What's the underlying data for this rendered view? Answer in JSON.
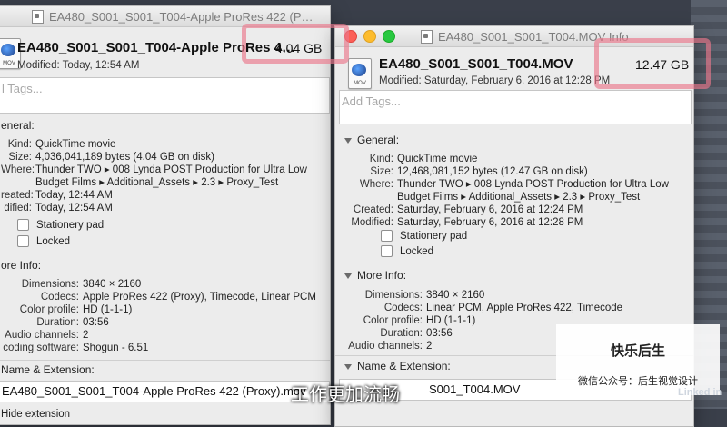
{
  "left_window": {
    "title": "EA480_S001_S001_T004-Apple ProRes 422 (P…",
    "filename": "EA480_S001_S001_T004-Apple ProRes 4…",
    "size": "4.04 GB",
    "modified": "Modified: Today, 12:54 AM",
    "tags_placeholder": "l Tags...",
    "general_label": "eneral:",
    "kind_k": "Kind:",
    "kind_v": "QuickTime movie",
    "size_k": "Size:",
    "size_v": "4,036,041,189 bytes (4.04 GB on disk)",
    "where_k": "Where:",
    "where_v1": "Thunder TWO ▸ 008 Lynda POST Production for Ultra Low",
    "where_v2": "Budget Films ▸ Additional_Assets ▸ 2.3 ▸ Proxy_Test",
    "created_k": "reated:",
    "created_v": "Today, 12:44 AM",
    "modified_k": "dified:",
    "modified_v": "Today, 12:54 AM",
    "stationery": "Stationery pad",
    "locked": "Locked",
    "more_info_label": "ore Info:",
    "dimensions_k": "Dimensions:",
    "dimensions_v": "3840 × 2160",
    "codecs_k": "Codecs:",
    "codecs_v": "Apple ProRes 422 (Proxy), Timecode, Linear PCM",
    "color_k": "Color profile:",
    "color_v": "HD (1-1-1)",
    "duration_k": "Duration:",
    "duration_v": "03:56",
    "audio_k": "Audio channels:",
    "audio_v": "2",
    "enc_k": "coding software:",
    "enc_v": "Shogun - 6.51",
    "name_ext_label": "Name & Extension:",
    "name_value": "EA480_S001_S001_T004-Apple ProRes 422 (Proxy).mov",
    "hide_ext": "Hide extension"
  },
  "right_window": {
    "title": "EA480_S001_S001_T004.MOV Info",
    "filename": "EA480_S001_S001_T004.MOV",
    "size": "12.47 GB",
    "modified": "Modified: Saturday, February 6, 2016 at 12:28 PM",
    "tags_placeholder": "Add Tags...",
    "general_label": "General:",
    "kind_k": "Kind:",
    "kind_v": "QuickTime movie",
    "size_k": "Size:",
    "size_v": "12,468,081,152 bytes (12.47 GB on disk)",
    "where_k": "Where:",
    "where_v1": "Thunder TWO ▸ 008 Lynda POST Production for Ultra Low",
    "where_v2": "Budget Films ▸ Additional_Assets ▸ 2.3 ▸ Proxy_Test",
    "created_k": "Created:",
    "created_v": "Saturday, February 6, 2016 at 12:24 PM",
    "modified_k": "Modified:",
    "modified_v": "Saturday, February 6, 2016 at 12:28 PM",
    "stationery": "Stationery pad",
    "locked": "Locked",
    "more_info_label": "More Info:",
    "dimensions_k": "Dimensions:",
    "dimensions_v": "3840 × 2160",
    "codecs_k": "Codecs:",
    "codecs_v": "Linear PCM, Apple ProRes 422, Timecode",
    "color_k": "Color profile:",
    "color_v": "HD (1-1-1)",
    "duration_k": "Duration:",
    "duration_v": "03:56",
    "audio_k": "Audio channels:",
    "audio_v": "2",
    "name_ext_label": "Name & Extension:",
    "name_value": "S001_T004.MOV"
  },
  "overlay": {
    "brand_title": "快乐后生",
    "brand_sub": "微信公众号：后生视觉设计",
    "subtitle": "工作更加流畅",
    "logo_text": "Linked in"
  },
  "colors": {
    "highlight": "#eb788c",
    "close": "#fc5f57",
    "minimize": "#fdbc2e",
    "zoom": "#28c840"
  }
}
